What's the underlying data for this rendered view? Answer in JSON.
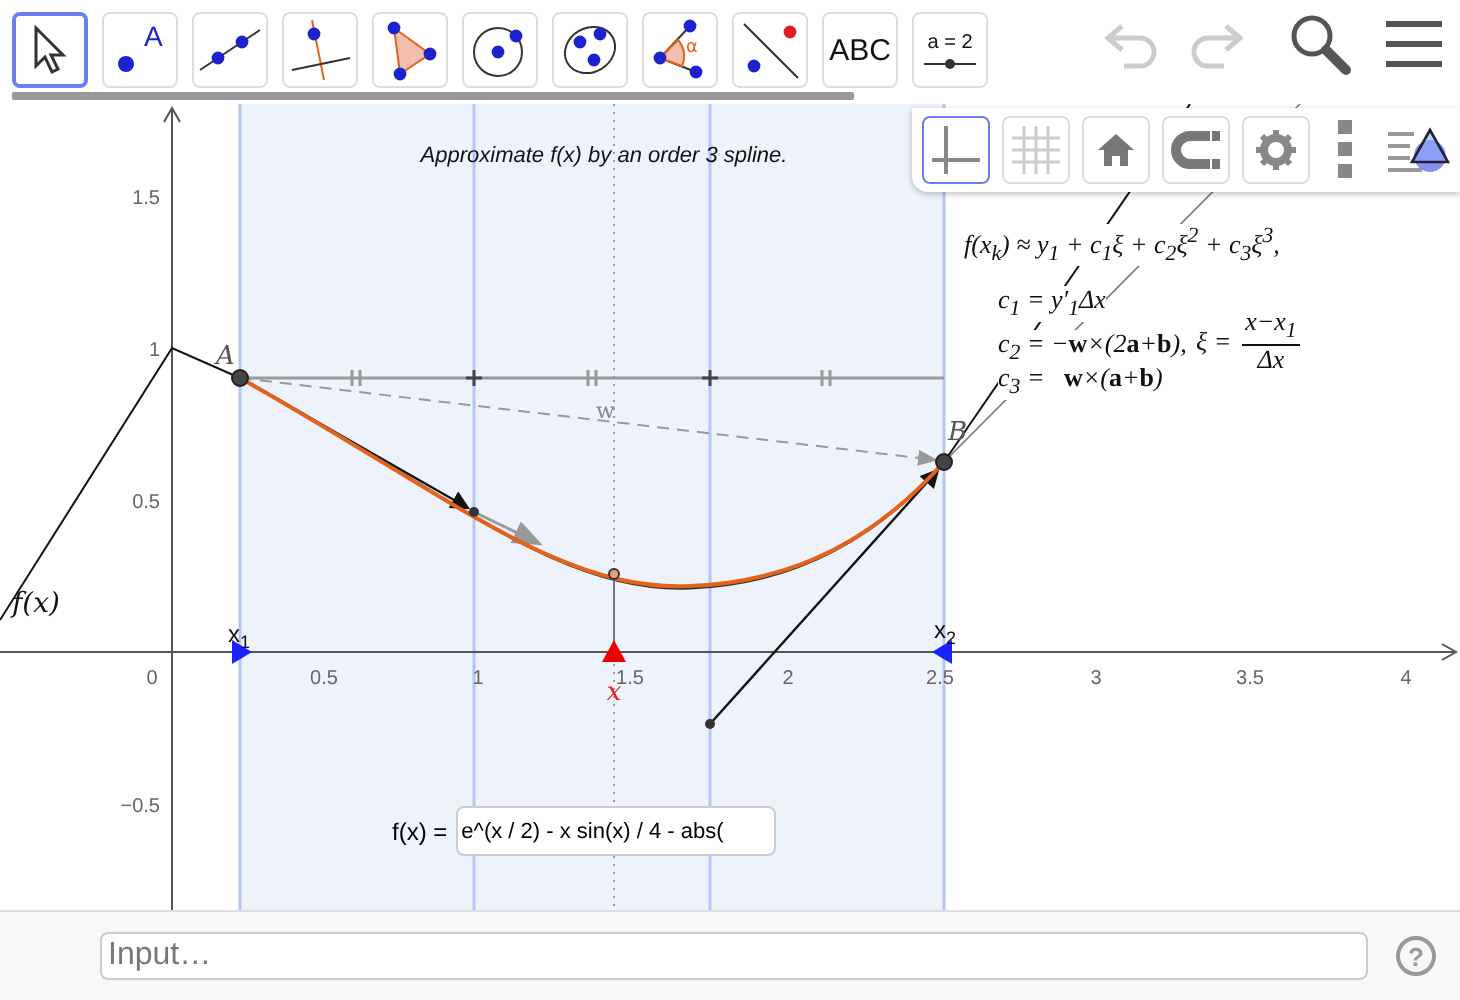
{
  "toolbar": {
    "tools": [
      {
        "kind": "move",
        "selected": true
      },
      {
        "kind": "point",
        "icon_text": "A",
        "selected": false
      },
      {
        "kind": "line",
        "selected": false
      },
      {
        "kind": "perpendicular",
        "selected": false
      },
      {
        "kind": "polygon",
        "selected": false
      },
      {
        "kind": "circle",
        "selected": false
      },
      {
        "kind": "conic",
        "selected": false
      },
      {
        "kind": "angle",
        "icon_text": "α",
        "selected": false
      },
      {
        "kind": "reflect",
        "selected": false
      },
      {
        "kind": "text",
        "label": "ABC",
        "selected": false
      },
      {
        "kind": "slider",
        "label": "a = 2",
        "selected": false
      }
    ],
    "undo": {
      "disabled": true
    },
    "redo": {
      "disabled": true
    }
  },
  "style_bar": [
    {
      "kind": "axes",
      "selected": true
    },
    {
      "kind": "grid",
      "selected": false
    },
    {
      "kind": "home"
    },
    {
      "kind": "snap"
    },
    {
      "kind": "settings"
    },
    {
      "kind": "more"
    },
    {
      "kind": "views"
    }
  ],
  "graphics": {
    "caption": "Approximate f(x) by an order 3 spline.",
    "x_ticks": [
      "0",
      "0.5",
      "1",
      "1.5",
      "2",
      "2.5",
      "3",
      "3.5",
      "4"
    ],
    "y_ticks": [
      "1.5",
      "1",
      "0.5",
      "−0.5"
    ],
    "labels": {
      "function": "f(x)",
      "point_a": "A",
      "point_b": "B",
      "vector_w": "w",
      "slider_x": "x"
    },
    "markers": [
      {
        "base": "x",
        "sub": "1"
      },
      {
        "base": "x",
        "sub": "2"
      }
    ],
    "formula": {
      "main": "f(x$_{k}$) ≈ y$_{1}$ + c$_{1}$ξ + c$_{2}$ξ$^{2}$ + c$_{3}$ξ$^{3}$,",
      "lines": [
        "c$_{1}$ = y′$_{1}$Δx",
        "c$_{2}$ = −**w**×(2**a**+**b**),",
        "c$_{3}$ =   **w**×(**a**+**b**)"
      ],
      "xi": "ξ =",
      "numerator": "x−x$_{1}$",
      "denominator": "Δx"
    },
    "input_box": {
      "label": "f(x) =",
      "value": "e^(x / 2) - x sin(x) / 4 - abs("
    }
  },
  "input_bar": {
    "placeholder": "Input…",
    "help": "?"
  }
}
